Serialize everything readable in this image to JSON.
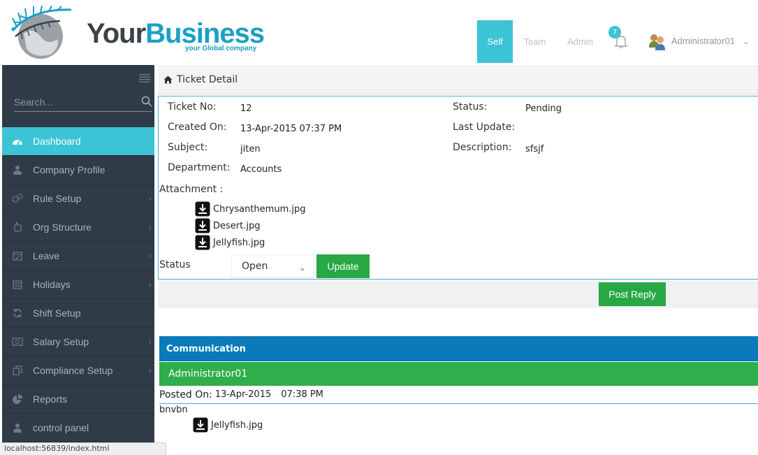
{
  "brand": {
    "part1": "Your",
    "part2": "Business",
    "tagline": "your Global company"
  },
  "nav": {
    "tabs": [
      "Self",
      "Team",
      "Admin"
    ],
    "active": "Self",
    "notifications_count": "7",
    "user": "Administrator01"
  },
  "sidebar": {
    "search_placeholder": "Search...",
    "items": [
      {
        "label": "Dashboard",
        "icon": "dashboard-icon",
        "chevron": false
      },
      {
        "label": "Company Profile",
        "icon": "user-icon",
        "chevron": false
      },
      {
        "label": "Rule Setup",
        "icon": "gears-icon",
        "chevron": true
      },
      {
        "label": "Org Structure",
        "icon": "hand-icon",
        "chevron": true
      },
      {
        "label": "Leave",
        "icon": "calendar-check-icon",
        "chevron": true
      },
      {
        "label": "Holidays",
        "icon": "calendar-icon",
        "chevron": true
      },
      {
        "label": "Shift Setup",
        "icon": "refresh-icon",
        "chevron": false
      },
      {
        "label": "Salary Setup",
        "icon": "money-icon",
        "chevron": true
      },
      {
        "label": "Compliance Setup",
        "icon": "copy-icon",
        "chevron": true
      },
      {
        "label": "Reports",
        "icon": "pie-chart-icon",
        "chevron": false
      },
      {
        "label": "control panel",
        "icon": "user-icon",
        "chevron": false
      }
    ]
  },
  "statusbar": {
    "url": "localhost:56839/index.html"
  },
  "ticket": {
    "breadcrumb": "Ticket Detail",
    "ticket_no_label": "Ticket No:",
    "ticket_no": "12",
    "created_on_label": "Created On:",
    "created_on": "13-Apr-2015 07:37 PM",
    "subject_label": "Subject:",
    "subject": "jiten",
    "department_label": "Department:",
    "department": "Accounts",
    "status_label": "Status:",
    "status": "Pending",
    "last_update_label": "Last Update:",
    "last_update": "",
    "description_label": "Description:",
    "description": "sfsjf",
    "attachment_label": "Attachment :",
    "attachments": [
      "Chrysanthemum.jpg",
      "Desert.jpg",
      "Jellyfish.jpg"
    ],
    "status_field_label": "Status",
    "status_select_value": "Open",
    "update_button": "Update",
    "post_reply_button": "Post Reply"
  },
  "communication": {
    "header": "Communication",
    "author": "Administrator01",
    "posted_label": "Posted On:",
    "posted_date": "13-Apr-2015",
    "posted_time": "07:38 PM",
    "message": "bnvbn",
    "attachment": "Jellyfish.jpg"
  },
  "colors": {
    "accent": "#3cc3d6",
    "sidebar": "#2f3b46",
    "green": "#28a745",
    "blue": "#0a7ab8"
  }
}
